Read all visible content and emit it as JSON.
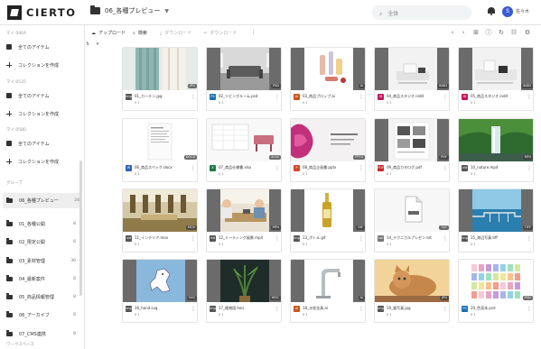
{
  "app": {
    "logo_text": "CIERTO"
  },
  "header": {
    "folder": "06_各種プレビュー",
    "search_placeholder": "全体",
    "user_initial": "S",
    "user_name": "佐々木"
  },
  "sidebar": {
    "sections": [
      {
        "label": "マイ 0464"
      },
      {
        "label": "マイ 0535"
      },
      {
        "label": "マイ 0580"
      },
      {
        "label": "グループ"
      },
      {
        "label": "ワークスペース"
      }
    ],
    "items": [
      {
        "label": "全てのアイテム"
      },
      {
        "label": "コレクションを作成"
      },
      {
        "label": "全てのアイテム"
      },
      {
        "label": "コレクションを作成"
      },
      {
        "label": "全てのアイテム"
      },
      {
        "label": "コレクションを作成"
      }
    ],
    "folders": [
      {
        "label": "06_各種プレビュー",
        "count": "24"
      },
      {
        "label": "01_各種公開",
        "count": "8"
      },
      {
        "label": "02_限定公開",
        "count": "6"
      },
      {
        "label": "03_素材管理",
        "count": "36"
      },
      {
        "label": "04_最新案件",
        "count": "8"
      },
      {
        "label": "05_商品情報管理",
        "count": "8"
      },
      {
        "label": "06_アーカイブ",
        "count": "8"
      },
      {
        "label": "07_CMS連携",
        "count": "8"
      }
    ]
  },
  "toolbar": {
    "upload": "アップロード",
    "search": "検索",
    "download": "ダウンロード",
    "share": "ダウンロード"
  },
  "cards": [
    {
      "name": "01_カーテン.jpg",
      "type": "img",
      "ext": "JPG",
      "stats": "0  1",
      "thumb": "curtain",
      "color": "#555"
    },
    {
      "name": "02_リビングルーム.psd",
      "type": "PS",
      "ext": "PSD",
      "stats": "0  1",
      "thumb": "living",
      "color": "#1b6fb3"
    },
    {
      "name": "03_商品プロップ.ai",
      "type": "AI",
      "ext": "AI",
      "stats": "0  1",
      "thumb": "bottles",
      "color": "#c9541a"
    },
    {
      "name": "04_商品スタジオ.indd",
      "type": "ID",
      "ext": "INDD",
      "stats": "0  1",
      "thumb": "studio",
      "color": "#c2185b"
    },
    {
      "name": "05_商品スタジオ.indd",
      "type": "ID",
      "ext": "INDD",
      "stats": "0  1",
      "thumb": "studio2",
      "color": "#c2185b"
    },
    {
      "name": "06_商品スペック.docx",
      "type": "W",
      "ext": "DOCX",
      "stats": "0  1",
      "thumb": "doc",
      "color": "#2f62b8"
    },
    {
      "name": "07_商品仕様書.xlsx",
      "type": "X",
      "ext": "XLSX",
      "stats": "0  1",
      "thumb": "sheet",
      "color": "#1e7b45"
    },
    {
      "name": "08_商品企画書.pptx",
      "type": "P",
      "ext": "PPTX",
      "stats": "0  1",
      "thumb": "slide",
      "color": "#d24726"
    },
    {
      "name": "09_商品カタログ.pdf",
      "type": "PDF",
      "ext": "PDF",
      "stats": "0  1",
      "thumb": "catalog",
      "color": "#c62828"
    },
    {
      "name": "10_nature.mp4",
      "type": "vid",
      "ext": "MP4",
      "stats": "0  1",
      "thumb": "waterfall",
      "color": "#555"
    },
    {
      "name": "11_インテリア.mov",
      "type": "vid",
      "ext": "MOV",
      "stats": "0  1",
      "thumb": "interior",
      "color": "#555"
    },
    {
      "name": "12_ミーティング風景.mp4",
      "type": "vid",
      "ext": "MP4",
      "stats": "0  1",
      "thumb": "meeting",
      "color": "#555"
    },
    {
      "name": "13_ボトル.gif",
      "type": "img",
      "ext": "GIF",
      "stats": "0  1",
      "thumb": "bottle",
      "color": "#555"
    },
    {
      "name": "14_テクニカルプレゼン.txt",
      "type": "txt",
      "ext": "TXT",
      "stats": "0  1",
      "thumb": "textfile",
      "color": "#777"
    },
    {
      "name": "15_海辺写真.tiff",
      "type": "img",
      "ext": "TIFF",
      "stats": "0  1",
      "thumb": "sea",
      "color": "#555"
    },
    {
      "name": "16_hand.svg",
      "type": "img",
      "ext": "SVG",
      "stats": "0  1",
      "thumb": "cartoon",
      "color": "#555"
    },
    {
      "name": "17_植物園.heic",
      "type": "img",
      "ext": "HEIC",
      "stats": "0  1",
      "thumb": "plant",
      "color": "#555"
    },
    {
      "name": "18_水栓金具.ai",
      "type": "AI",
      "ext": "AI",
      "stats": "0  1",
      "thumb": "faucet",
      "color": "#c9541a"
    },
    {
      "name": "19_猫写真.jpg",
      "type": "img",
      "ext": "JPG",
      "stats": "0  1",
      "thumb": "cat",
      "color": "#555"
    },
    {
      "name": "20_色見本.psd",
      "type": "PS",
      "ext": "PSD",
      "stats": "0  1",
      "thumb": "swatch",
      "color": "#1b6fb3"
    }
  ]
}
